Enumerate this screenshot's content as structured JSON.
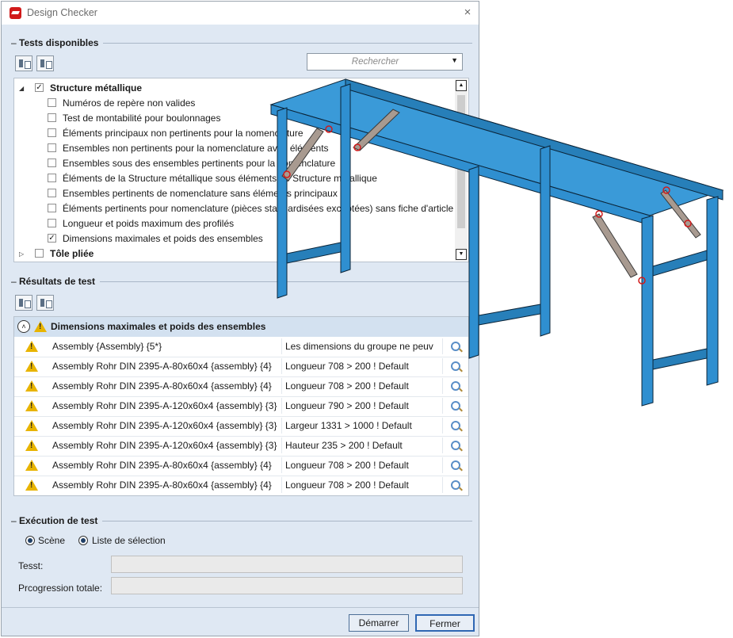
{
  "window": {
    "title": "Design Checker",
    "close_icon": "×"
  },
  "tests": {
    "header": "Tests disponibles",
    "search_placeholder": "Rechercher",
    "tree": [
      {
        "label": "Structure métallique",
        "level": 0,
        "checked": true,
        "expanded": true,
        "bold": true
      },
      {
        "label": "Numéros de repère non valides",
        "level": 1,
        "checked": false
      },
      {
        "label": "Test de montabilité pour boulonnages",
        "level": 1,
        "checked": false
      },
      {
        "label": "Éléments principaux non pertinents pour la nomenclature",
        "level": 1,
        "checked": false
      },
      {
        "label": "Ensembles non pertinents pour la nomenclature avec éléments",
        "level": 1,
        "checked": false
      },
      {
        "label": "Ensembles sous des ensembles pertinents pour la nomenclature",
        "level": 1,
        "checked": false
      },
      {
        "label": "Éléments de la Structure métallique sous éléments de Structure métallique",
        "level": 1,
        "checked": false
      },
      {
        "label": "Ensembles pertinents de nomenclature sans éléments principaux",
        "level": 1,
        "checked": false
      },
      {
        "label": "Éléments pertinents pour nomenclature (pièces standardisées exceptées) sans fiche d'article",
        "level": 1,
        "checked": false
      },
      {
        "label": "Longueur et poids maximum des profilés",
        "level": 1,
        "checked": false
      },
      {
        "label": "Dimensions maximales et poids des ensembles",
        "level": 1,
        "checked": true
      },
      {
        "label": "Tôle pliée",
        "level": 0,
        "checked": false,
        "expanded": false,
        "bold": true
      }
    ]
  },
  "results": {
    "header": "Résultats de test",
    "group_title": "Dimensions maximales et poids des ensembles",
    "rows": [
      {
        "name": "Assembly {Assembly} {5*}",
        "message": "Les dimensions du groupe ne peuv"
      },
      {
        "name": "Assembly Rohr DIN 2395-A-80x60x4 {assembly} {4}",
        "message": "Longueur 708 > 200 ! Default"
      },
      {
        "name": "Assembly Rohr DIN 2395-A-80x60x4 {assembly} {4}",
        "message": "Longueur 708 > 200 ! Default"
      },
      {
        "name": "Assembly Rohr DIN 2395-A-120x60x4 {assembly} {3}",
        "message": "Longueur 790 > 200 ! Default"
      },
      {
        "name": "Assembly Rohr DIN 2395-A-120x60x4 {assembly} {3}",
        "message": "Largeur 1331 > 1000 ! Default"
      },
      {
        "name": "Assembly Rohr DIN 2395-A-120x60x4 {assembly} {3}",
        "message": "Hauteur 235 > 200 ! Default"
      },
      {
        "name": "Assembly Rohr DIN 2395-A-80x60x4 {assembly} {4}",
        "message": "Longueur 708 > 200 ! Default"
      },
      {
        "name": "Assembly Rohr DIN 2395-A-80x60x4 {assembly} {4}",
        "message": "Longueur 708 > 200 ! Default"
      }
    ]
  },
  "execution": {
    "header": "Exécution de test",
    "radio_scene": "Scène",
    "radio_selection": "Liste de sélection",
    "test_label": "Tesst:",
    "progress_label": "Prcogression totale:",
    "start_button": "Démarrer",
    "close_button": "Fermer"
  },
  "colors": {
    "steel": "#2f8fd0",
    "brace": "#a89a90",
    "accent_red": "#d11a1a"
  }
}
